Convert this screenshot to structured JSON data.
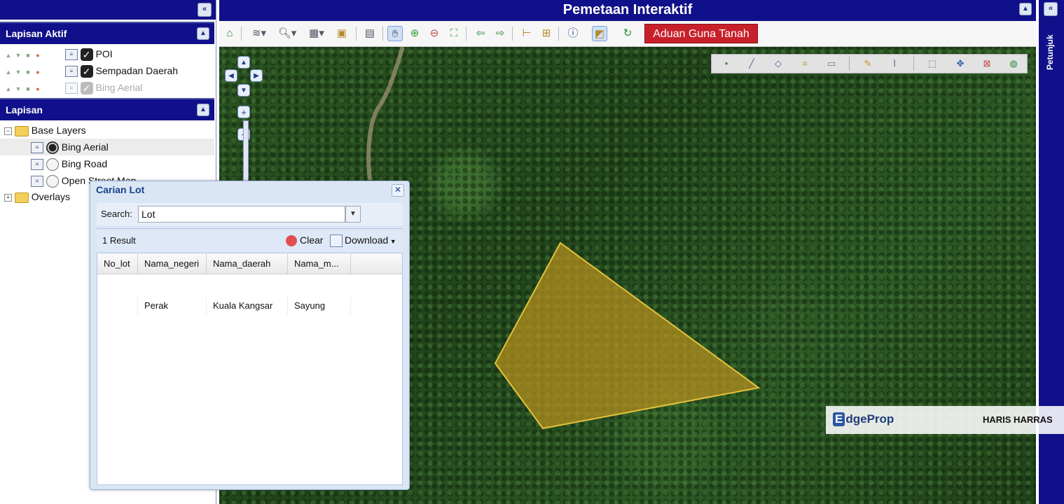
{
  "app": {
    "title": "Pemetaan Interaktif",
    "right_rail_label": "Petunjuk",
    "collapse_glyph": "«"
  },
  "left_panel": {
    "active_layers": {
      "header": "Lapisan Aktif",
      "items": [
        {
          "label": "POI",
          "checked": true
        },
        {
          "label": "Sempadan Daerah",
          "checked": true
        },
        {
          "label": "Bing Aerial",
          "checked": true,
          "dimmed": true
        }
      ]
    },
    "layers": {
      "header": "Lapisan",
      "base_folder": "Base Layers",
      "base_items": [
        {
          "label": "Bing Aerial",
          "selected": true
        },
        {
          "label": "Bing Road",
          "selected": false
        },
        {
          "label": "Open Street Map",
          "selected": false
        }
      ],
      "overlays_folder": "Overlays"
    }
  },
  "toolbar": {
    "complaint_button": "Aduan Guna Tanah",
    "icons": [
      "home-icon",
      "layers-icon",
      "zoom-icon",
      "grid-icon",
      "map-icon",
      "save-icon",
      "pan-icon",
      "zoom-in-icon",
      "zoom-out-icon",
      "full-extent-icon",
      "back-arrow-icon",
      "forward-arrow-icon",
      "measure-distance-icon",
      "measure-area-icon",
      "info-icon",
      "select-icon",
      "refresh-icon"
    ]
  },
  "edit_toolbar": {
    "icons": [
      "add-point-icon",
      "add-line-icon",
      "add-polygon-icon",
      "edit-vertices-icon",
      "eraser-icon",
      "pencil-icon",
      "paint-icon",
      "select-feature-icon",
      "move-icon",
      "delete-feature-icon",
      "globe-icon"
    ]
  },
  "dialog": {
    "title": "Carian Lot",
    "search_label": "Search:",
    "search_value": "Lot",
    "result_count": "1 Result",
    "clear_label": "Clear",
    "download_label": "Download",
    "columns": [
      "No_lot",
      "Nama_negeri",
      "Nama_daerah",
      "Nama_m..."
    ],
    "rows": [
      {
        "no_lot": "",
        "nama_negeri": "Perak",
        "nama_daerah": "Kuala Kangsar",
        "nama_m": "Sayung"
      }
    ]
  },
  "watermark": {
    "logo_prefix": "E",
    "logo_text": "dgeProp",
    "author": "HARIS HARRAS"
  },
  "colors": {
    "header_blue": "#10108a",
    "complaint_red": "#c8202a",
    "lot_fill": "#b8921e",
    "lot_stroke": "#e6c23a"
  }
}
